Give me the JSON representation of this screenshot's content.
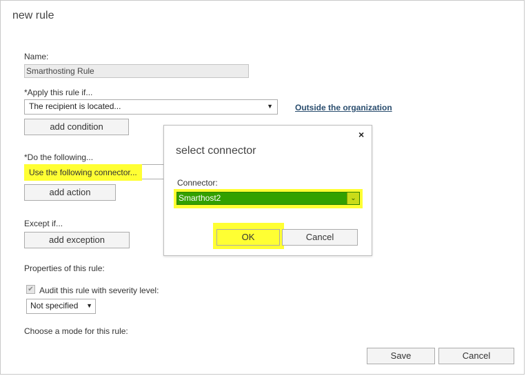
{
  "window": {
    "title": "new rule"
  },
  "form": {
    "name_label": "Name:",
    "name_value": "Smarthosting Rule",
    "apply_label": "*Apply this rule if...",
    "apply_select": "The recipient is located...",
    "apply_link": "Outside the organization",
    "add_condition": "add condition",
    "do_label": "*Do the following...",
    "do_select": "Use the following connector...",
    "add_action": "add action",
    "except_label": "Except if...",
    "add_exception": "add exception",
    "properties_label": "Properties of this rule:",
    "audit_label": "Audit this rule with severity level:",
    "audit_checked": true,
    "severity_select": "Not specified",
    "mode_label": "Choose a mode for this rule:"
  },
  "footer": {
    "save": "Save",
    "cancel": "Cancel"
  },
  "dialog": {
    "title": "select connector",
    "close": "×",
    "connector_label": "Connector:",
    "connector_value": "Smarthost2",
    "ok": "OK",
    "cancel": "Cancel"
  },
  "colors": {
    "highlight": "#ffff33",
    "selected_bg": "#33a000",
    "link": "#2a4d6e"
  }
}
